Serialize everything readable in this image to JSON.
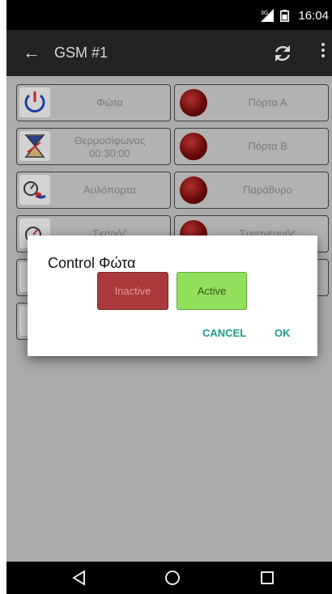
{
  "status_bar": {
    "time": "16:04",
    "network": "3G"
  },
  "app_bar": {
    "title": "GSM #1"
  },
  "tiles_left": [
    {
      "label": "Φώτα",
      "icon": "power-icon"
    },
    {
      "label": "Θερμοσίφωνας",
      "sublabel": "00:30:00",
      "icon": "hourglass-icon"
    },
    {
      "label": "Αυλόπορτα",
      "icon": "door-remote-icon"
    },
    {
      "label": "Σκαρόζ",
      "icon": "gauge-icon"
    }
  ],
  "tiles_right": [
    {
      "label": "Πόρτα Α",
      "indicator": "red"
    },
    {
      "label": "Πόρτα Β",
      "indicator": "red"
    },
    {
      "label": "Παράθυρο",
      "indicator": "red"
    },
    {
      "label": "Συναγερμός",
      "indicator": "red"
    }
  ],
  "dialog": {
    "title": "Control Φώτα",
    "inactive_label": "Inactive",
    "active_label": "Active",
    "cancel_label": "CANCEL",
    "ok_label": "OK"
  },
  "colors": {
    "inactive_button": "#a9393a",
    "active_button": "#92df5c",
    "dialog_action": "#1e9a8a",
    "led_red": "#8a1010"
  }
}
